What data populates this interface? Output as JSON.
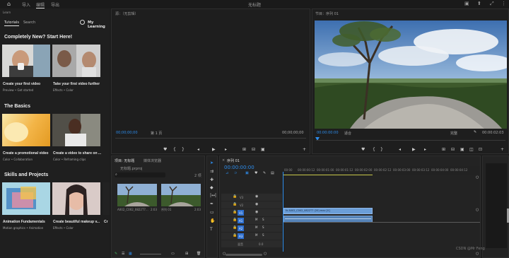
{
  "topbar": {
    "tabs": [
      {
        "label": "导入"
      },
      {
        "label": "编辑"
      },
      {
        "label": "导出"
      }
    ],
    "active_tab": "编辑",
    "title": "无标题"
  },
  "learn": {
    "panel_title": "Learn",
    "tabs": [
      "Tutorials",
      "Search"
    ],
    "my_learning": "My Learning",
    "sections": [
      {
        "title": "Completely New? Start Here!",
        "cards": [
          {
            "title": "Create your first video",
            "sub": "Preview  •  Get started"
          },
          {
            "title": "Take your first video further",
            "sub": "Effects  •  Color"
          }
        ]
      },
      {
        "title": "The Basics",
        "cards": [
          {
            "title": "Create a promotional video",
            "sub": "Color  •  Collaboration"
          },
          {
            "title": "Create a video to share on ...",
            "sub": "Color  •  Reframing clips"
          }
        ]
      },
      {
        "title": "Skills and Projects",
        "cards": [
          {
            "title": "Animation Fundamentals",
            "sub": "Motion graphics  •  Animation"
          },
          {
            "title": "Create beautiful makeup v...",
            "sub": "Effects  •  Color"
          },
          {
            "title": "Cr",
            "sub": ""
          }
        ]
      }
    ]
  },
  "source": {
    "header": "源：（无剪辑）",
    "tc_left": "00;00;00;00",
    "page": "第 1 页",
    "tc_right": "00;00;00;00"
  },
  "program": {
    "header": "节目：序列 01",
    "tc_left": "00:00:00:00",
    "fit": "适合",
    "quality": "完整",
    "tc_right": "00:00:02:03"
  },
  "project": {
    "tabs": [
      "项目: 无标题",
      "媒体浏览器"
    ],
    "filename": "无标题.prproj",
    "count": "2 项",
    "clips": [
      {
        "name": "A002_C002_0822T7...",
        "dur": "2:03"
      },
      {
        "name": "序列 01",
        "dur": "2:03"
      }
    ]
  },
  "timeline": {
    "tab": "序列 01",
    "timecode": "00:00:00:00",
    "ruler": [
      "00:00",
      "00:00:00:12",
      "00:00:01:00",
      "00:00:01:12",
      "00:00:02:00",
      "00:00:02:12",
      "00:00:03:00",
      "00:00:03:12",
      "00:00:04:00",
      "00:00:04:12"
    ],
    "tracks_video": [
      "V3",
      "V2",
      "V1"
    ],
    "tracks_audio": [
      "A1",
      "A2",
      "A3"
    ],
    "master": "混音",
    "master_val": "0.0",
    "clip_label": "fx A002_C002_0822T7 (20).mov [V]"
  },
  "colors": {
    "accent": "#2d8ceb",
    "clip": "#5d8ec4",
    "playhead": "#2d8ceb"
  },
  "watermark": "CSDN @Mr Feng"
}
